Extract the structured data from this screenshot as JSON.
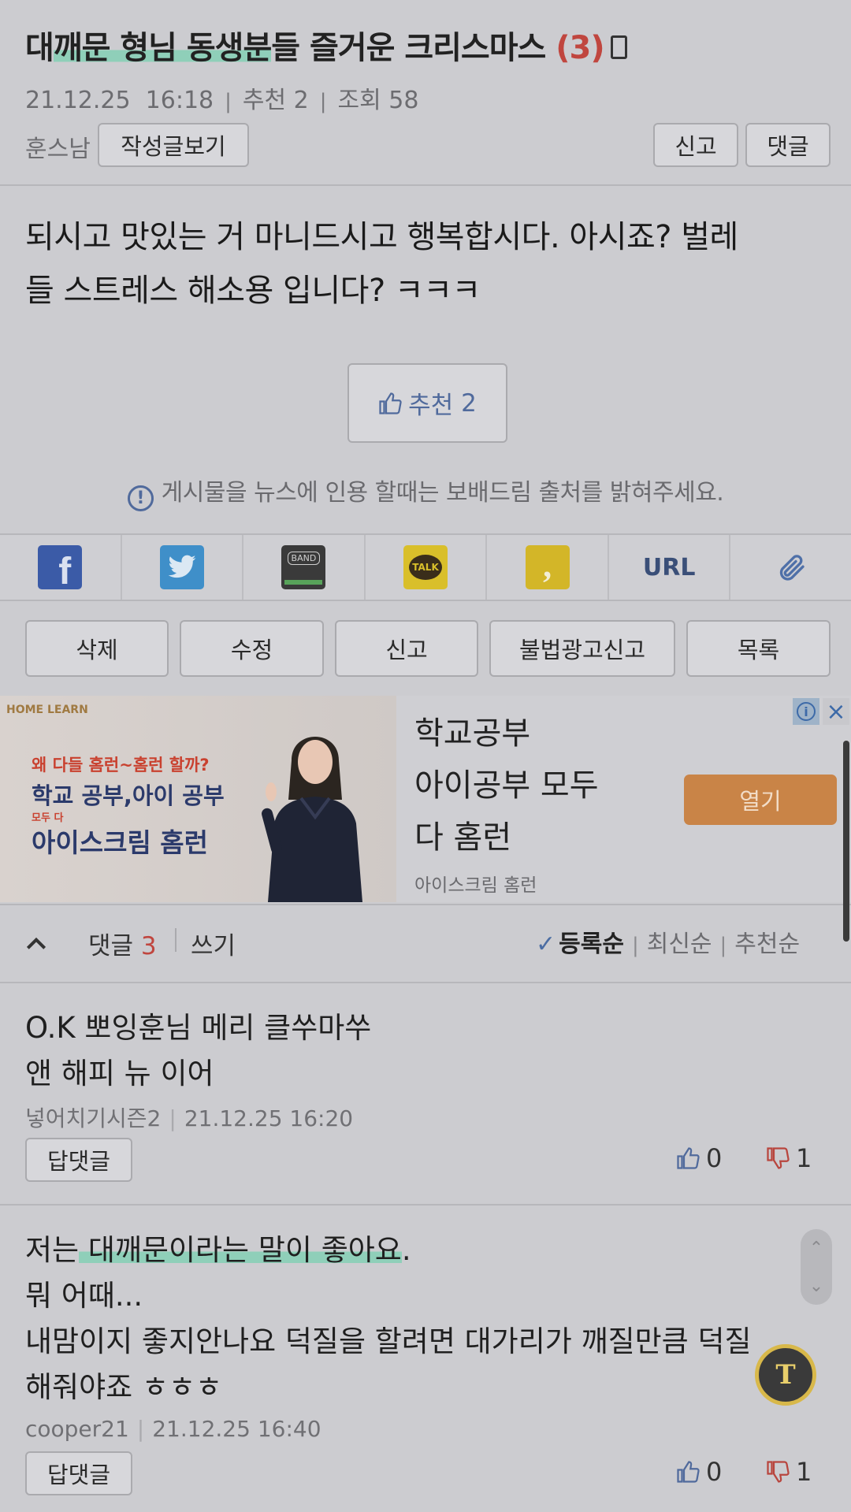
{
  "post": {
    "title_plain": "대",
    "title_hl": "깨문 형님 동생분",
    "title_rest": "들 즐거운 크리스마스",
    "comment_count_badge": "(3)",
    "date": "21.12.25",
    "time": "16:18",
    "recommend_label": "추천",
    "recommend_count": "2",
    "views_label": "조회",
    "views_count": "58",
    "author": "훈스남",
    "view_posts_button": "작성글보기",
    "report_button": "신고",
    "comment_button": "댓글",
    "body_line1": "되시고 맛있는 거 마니드시고 행복합시다. 아시죠?  벌레",
    "body_line2": "들 스트레스 해소용 입니다?  ㅋㅋㅋ",
    "recommend_button_label": "추천",
    "recommend_button_count": "2",
    "notice": "게시물을 뉴스에 인용 할때는 보배드림 출처를 밝혀주세요."
  },
  "share": {
    "items": [
      "facebook",
      "twitter",
      "band",
      "kakaotalk",
      "kakaostory",
      "url",
      "attachment"
    ],
    "band_label": "BAND",
    "talk_label": "TALK",
    "url_label": "URL"
  },
  "actions": {
    "delete": "삭제",
    "edit": "수정",
    "report": "신고",
    "illegal_ad_report": "불법광고신고",
    "list": "목록"
  },
  "ad": {
    "brand": "HOME LEARN",
    "img_line1": "왜 다들 홈런~홈런 할까?",
    "img_line2": "학교 공부,아이 공부",
    "img_line3": "모두 다",
    "img_line4": "아이스크림 홈런",
    "line1": "학교공부",
    "line2": "아이공부 모두",
    "line3": "다 홈런",
    "open_button": "열기",
    "source": "아이스크림 홈런",
    "info_icon": "info-icon",
    "close_icon": "close-icon"
  },
  "comments_header": {
    "label": "댓글",
    "count": "3",
    "write": "쓰기",
    "sort_registered": "등록순",
    "sort_latest": "최신순",
    "sort_recommended": "추천순"
  },
  "comments": [
    {
      "line1": "O.K 뽀잉훈님 메리 클쑤마쑤",
      "line2": "앤 해피 뉴 이어",
      "author": "넣어치기시즌2",
      "datetime": "21.12.25  16:20",
      "reply_button": "답댓글",
      "likes": "0",
      "dislikes": "1"
    },
    {
      "line1_plain": "저는",
      "line1_hl": " 대깨문이라는 말이 좋아요",
      "line1_end": ".",
      "line2": "뭐 어때...",
      "line3": "내맘이지 좋지안나요 덕질을 할려면 대가리가 깨질만큼 덕질",
      "line4": "해줘야죠 ㅎㅎㅎ",
      "author": "cooper21",
      "datetime": "21.12.25  16:40",
      "reply_button": "답댓글",
      "likes": "0",
      "dislikes": "1"
    }
  ],
  "colors": {
    "accent_red": "#c0463f",
    "accent_blue": "#506a9c",
    "highlight": "#8fcfb9",
    "background": "#ccccd0"
  },
  "translate_fab_label": "T"
}
